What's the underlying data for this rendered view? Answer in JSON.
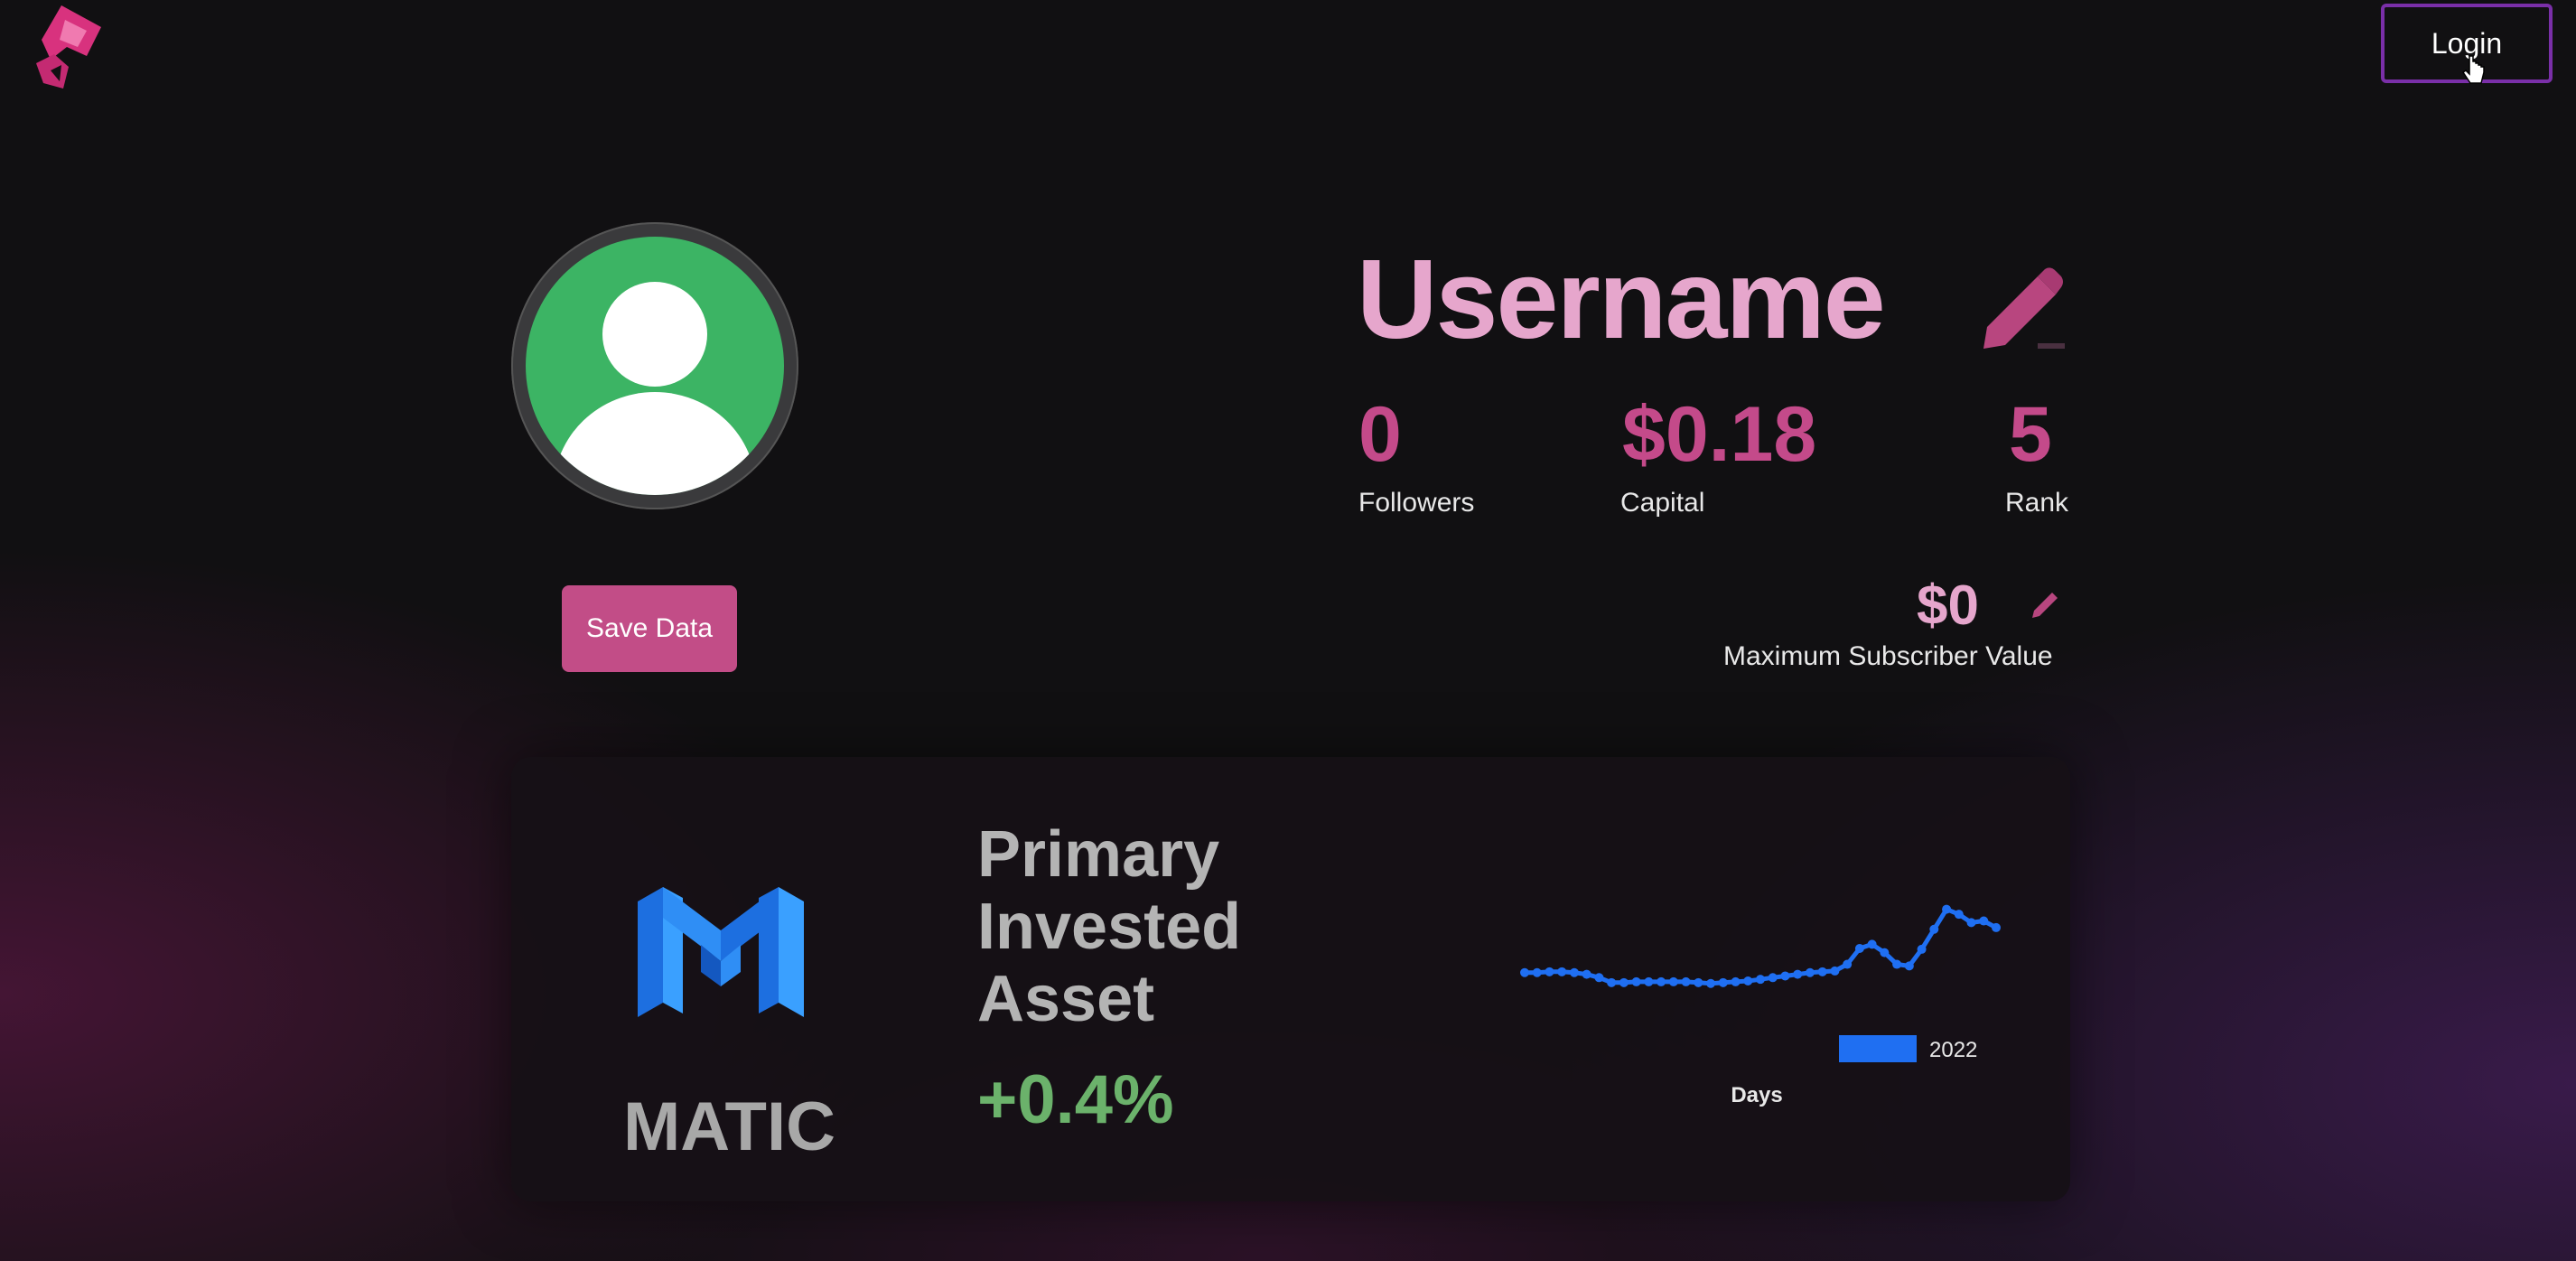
{
  "header": {
    "login_label": "Login"
  },
  "profile": {
    "username": "Username",
    "save_label": "Save Data",
    "stats": {
      "followers": {
        "value": "0",
        "label": "Followers"
      },
      "capital": {
        "value": "$0.18",
        "label": "Capital"
      },
      "rank": {
        "value": "5",
        "label": "Rank"
      }
    },
    "max_subscriber": {
      "value": "$0",
      "label": "Maximum Subscriber Value"
    }
  },
  "asset_card": {
    "token": "MATIC",
    "title_lines": [
      "Primary",
      "Invested",
      "Asset"
    ],
    "change": "+0.4%"
  },
  "colors": {
    "accent_pink": "#c44a8a",
    "username_pink": "#e6a6cc",
    "avatar_green": "#3cb464",
    "login_border": "#7a2fa8",
    "positive_green": "#6bb26b",
    "chart_blue": "#1f6ff2"
  },
  "chart_data": {
    "type": "line",
    "xlabel": "Days",
    "ylabel": "",
    "series": [
      {
        "name": "2022",
        "values": [
          0.66,
          0.66,
          0.67,
          0.67,
          0.66,
          0.64,
          0.6,
          0.54,
          0.54,
          0.55,
          0.55,
          0.55,
          0.55,
          0.55,
          0.54,
          0.53,
          0.54,
          0.55,
          0.56,
          0.58,
          0.6,
          0.62,
          0.64,
          0.66,
          0.67,
          0.68,
          0.76,
          0.95,
          1.0,
          0.9,
          0.76,
          0.74,
          0.94,
          1.18,
          1.42,
          1.36,
          1.26,
          1.28,
          1.2
        ]
      }
    ],
    "ylim": [
      0.3,
      1.6
    ]
  }
}
